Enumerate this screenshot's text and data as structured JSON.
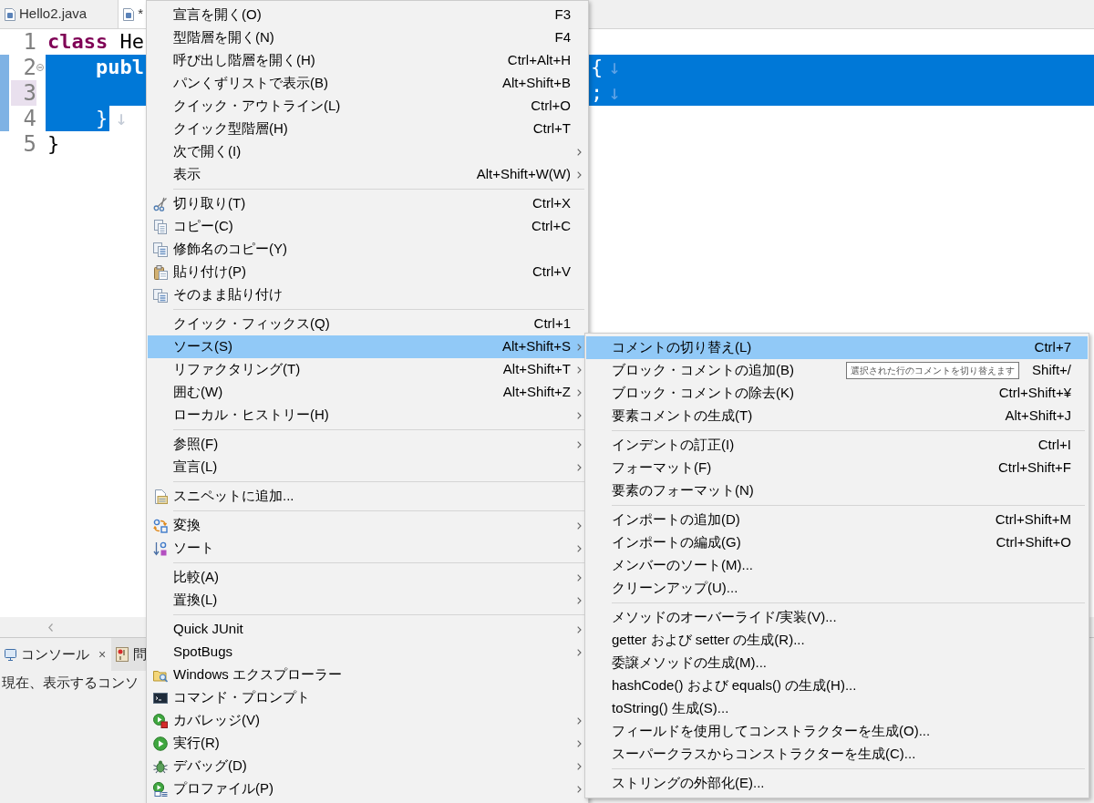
{
  "editor_tabs": [
    {
      "label": "Hello2.java",
      "selected": false
    },
    {
      "label": "*",
      "selected": true
    }
  ],
  "editor": {
    "lines": [
      {
        "number": "1",
        "indented": false,
        "segments": [
          {
            "kind": "keyword",
            "text": "class"
          },
          {
            "kind": "plain",
            "text": "He"
          }
        ],
        "selected": false,
        "current": false,
        "foldable": false
      },
      {
        "number": "2",
        "indented": true,
        "segments": [
          {
            "kind": "keyword",
            "text": "publ"
          }
        ],
        "tail": [
          {
            "kind": "plain",
            "text": "{"
          }
        ],
        "eol": "↓",
        "selected": true,
        "to_line_end": true,
        "current": false,
        "foldable": true
      },
      {
        "number": "3",
        "tail": [
          {
            "kind": "plain",
            "text": ";"
          }
        ],
        "eol": "↓",
        "selected": true,
        "to_line_end": true,
        "current": true,
        "foldable": false
      },
      {
        "number": "4",
        "indented": true,
        "segments": [
          {
            "kind": "plain",
            "text": "}"
          }
        ],
        "eol": "↓",
        "selected": true,
        "to_line_end": false,
        "current": false,
        "foldable": false
      },
      {
        "number": "5",
        "indented": false,
        "segments": [
          {
            "kind": "plain",
            "text": "}"
          }
        ],
        "selected": false,
        "current": false,
        "foldable": false
      }
    ]
  },
  "bottom_panel": {
    "tabs": [
      {
        "label": "コンソール",
        "close": "×",
        "selected": true
      },
      {
        "label": "問",
        "selected": false
      }
    ],
    "message": "現在、表示するコンソ"
  },
  "context_menu": {
    "groups": [
      [
        {
          "label": "宣言を開く(O)",
          "shortcut": "F3",
          "submenu": false,
          "selected": false
        },
        {
          "label": "型階層を開く(N)",
          "shortcut": "F4",
          "submenu": false,
          "selected": false
        },
        {
          "label": "呼び出し階層を開く(H)",
          "shortcut": "Ctrl+Alt+H",
          "submenu": false,
          "selected": false
        },
        {
          "label": "パンくずリストで表示(B)",
          "shortcut": "Alt+Shift+B",
          "submenu": false,
          "selected": false
        },
        {
          "label": "クイック・アウトライン(L)",
          "shortcut": "Ctrl+O",
          "submenu": false,
          "selected": false
        },
        {
          "label": "クイック型階層(H)",
          "shortcut": "Ctrl+T",
          "submenu": false,
          "selected": false
        },
        {
          "label": "次で開く(I)",
          "submenu": true,
          "selected": false
        },
        {
          "label": "表示",
          "shortcut": "Alt+Shift+W(W)",
          "submenu": true,
          "selected": false
        }
      ],
      [
        {
          "label": "切り取り(T)",
          "shortcut": "Ctrl+X",
          "submenu": false,
          "selected": false
        },
        {
          "label": "コピー(C)",
          "shortcut": "Ctrl+C",
          "submenu": false,
          "selected": false
        },
        {
          "label": "修飾名のコピー(Y)",
          "submenu": false,
          "selected": false
        },
        {
          "label": "貼り付け(P)",
          "shortcut": "Ctrl+V",
          "submenu": false,
          "selected": false
        },
        {
          "label": "そのまま貼り付け",
          "submenu": false,
          "selected": false
        }
      ],
      [
        {
          "label": "クイック・フィックス(Q)",
          "shortcut": "Ctrl+1",
          "submenu": false,
          "selected": false
        },
        {
          "label": "ソース(S)",
          "shortcut": "Alt+Shift+S",
          "submenu": true,
          "selected": true
        },
        {
          "label": "リファクタリング(T)",
          "shortcut": "Alt+Shift+T",
          "submenu": true,
          "selected": false
        },
        {
          "label": "囲む(W)",
          "shortcut": "Alt+Shift+Z",
          "submenu": true,
          "selected": false
        },
        {
          "label": "ローカル・ヒストリー(H)",
          "submenu": true,
          "selected": false
        }
      ],
      [
        {
          "label": "参照(F)",
          "submenu": true,
          "selected": false
        },
        {
          "label": "宣言(L)",
          "submenu": true,
          "selected": false
        }
      ],
      [
        {
          "label": "スニペットに追加...",
          "submenu": false,
          "selected": false
        }
      ],
      [
        {
          "label": "変換",
          "submenu": true,
          "selected": false
        },
        {
          "label": "ソート",
          "submenu": true,
          "selected": false
        }
      ],
      [
        {
          "label": "比較(A)",
          "submenu": true,
          "selected": false
        },
        {
          "label": "置換(L)",
          "submenu": true,
          "selected": false
        }
      ],
      [
        {
          "label": "Quick JUnit",
          "submenu": true,
          "selected": false
        },
        {
          "label": "SpotBugs",
          "submenu": true,
          "selected": false
        },
        {
          "label": "Windows エクスプローラー",
          "submenu": false,
          "selected": false
        },
        {
          "label": "コマンド・プロンプト",
          "submenu": false,
          "selected": false
        },
        {
          "label": "カバレッジ(V)",
          "submenu": true,
          "selected": false
        },
        {
          "label": "実行(R)",
          "submenu": true,
          "selected": false
        },
        {
          "label": "デバッグ(D)",
          "submenu": true,
          "selected": false
        },
        {
          "label": "プロファイル(P)",
          "submenu": true,
          "selected": false
        }
      ]
    ]
  },
  "source_submenu": {
    "groups": [
      [
        {
          "label": "コメントの切り替え(L)",
          "shortcut": "Ctrl+7",
          "selected": true
        },
        {
          "label": "ブロック・コメントの追加(B)",
          "shortcut": "Shift+/",
          "selected": false
        },
        {
          "label": "ブロック・コメントの除去(K)",
          "shortcut": "Ctrl+Shift+¥",
          "selected": false
        },
        {
          "label": "要素コメントの生成(T)",
          "shortcut": "Alt+Shift+J",
          "selected": false
        }
      ],
      [
        {
          "label": "インデントの訂正(I)",
          "shortcut": "Ctrl+I",
          "selected": false
        },
        {
          "label": "フォーマット(F)",
          "shortcut": "Ctrl+Shift+F",
          "selected": false
        },
        {
          "label": "要素のフォーマット(N)",
          "selected": false
        }
      ],
      [
        {
          "label": "インポートの追加(D)",
          "shortcut": "Ctrl+Shift+M",
          "selected": false
        },
        {
          "label": "インポートの編成(G)",
          "shortcut": "Ctrl+Shift+O",
          "selected": false
        },
        {
          "label": "メンバーのソート(M)...",
          "selected": false
        },
        {
          "label": "クリーンアップ(U)...",
          "selected": false
        }
      ],
      [
        {
          "label": "メソッドのオーバーライド/実装(V)...",
          "selected": false
        },
        {
          "label": "getter および setter の生成(R)...",
          "selected": false
        },
        {
          "label": "委譲メソッドの生成(M)...",
          "selected": false
        },
        {
          "label": "hashCode() および equals() の生成(H)...",
          "selected": false
        },
        {
          "label": "toString() 生成(S)...",
          "selected": false
        },
        {
          "label": "フィールドを使用してコンストラクターを生成(O)...",
          "selected": false
        },
        {
          "label": "スーパークラスからコンストラクターを生成(C)...",
          "selected": false
        }
      ],
      [
        {
          "label": "ストリングの外部化(E)...",
          "selected": false
        }
      ]
    ]
  },
  "tooltip": {
    "text": "選択された行のコメントを切り替えます"
  }
}
